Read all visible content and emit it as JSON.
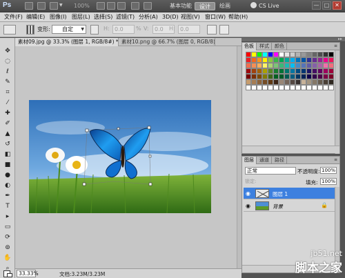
{
  "app": {
    "logo": "Ps",
    "zoom_display": "100%",
    "workspaces": [
      "基本功能",
      "设计",
      "绘画"
    ],
    "workspace_active": "设计",
    "live": "CS Live",
    "win_minimize": "—",
    "win_restore": "□",
    "win_close": "✕"
  },
  "menu": [
    "文件(F)",
    "编辑(E)",
    "图像(I)",
    "图层(L)",
    "选择(S)",
    "滤镜(T)",
    "分析(A)",
    "3D(D)",
    "视图(V)",
    "窗口(W)",
    "帮助(H)"
  ],
  "options": {
    "warp_label": "变形:",
    "warp_value": "自定",
    "h_label": "H:",
    "h_value": "0.0",
    "v_label": "V:",
    "v_value": "0.0",
    "h2_label": "H:",
    "h2_value": "0.0",
    "percent": "%"
  },
  "tabs": [
    {
      "label": "素材09.jpg @ 33.3% (图层 1, RGB/8#) *",
      "close": "×"
    },
    {
      "label": "素材10.png @ 66.7% (图层 0, RGB/8)",
      "close": "×"
    }
  ],
  "status": {
    "zoom": "33.33%",
    "doc": "文档:3.23M/3.23M"
  },
  "color_panel": {
    "tabs": [
      "色板",
      "样式",
      "颜色"
    ],
    "swatches": [
      "#ff0000",
      "#ffff00",
      "#00ff00",
      "#00ffff",
      "#0000ff",
      "#ff00ff",
      "#ffffff",
      "#e6e6e6",
      "#cccccc",
      "#b3b3b3",
      "#999999",
      "#808080",
      "#666666",
      "#4d4d4d",
      "#333333",
      "#000000",
      "#ee1d24",
      "#f26522",
      "#f7941d",
      "#fff200",
      "#8dc63f",
      "#39b54a",
      "#00a651",
      "#00a99d",
      "#00aeef",
      "#0072bc",
      "#0054a6",
      "#2e3192",
      "#662d91",
      "#92278f",
      "#ec008c",
      "#ed145b",
      "#f26c4f",
      "#f68e55",
      "#fbaf5c",
      "#fff467",
      "#acd372",
      "#7cc576",
      "#3bb878",
      "#1abbb4",
      "#00bff3",
      "#438cca",
      "#5574b9",
      "#605ca8",
      "#8560a8",
      "#a864a8",
      "#f06eaa",
      "#f26d7d",
      "#9e0b0f",
      "#a0410d",
      "#a36209",
      "#aba000",
      "#598527",
      "#1a7b30",
      "#007236",
      "#00746b",
      "#0076a3",
      "#004a80",
      "#003471",
      "#1b1464",
      "#440e62",
      "#630460",
      "#9e005d",
      "#9e0039",
      "#790000",
      "#7b2e00",
      "#7d4900",
      "#827b00",
      "#406618",
      "#005e20",
      "#005826",
      "#005952",
      "#005b7f",
      "#003663",
      "#002157",
      "#0d004c",
      "#32004b",
      "#4b0049",
      "#7b0046",
      "#7a0026",
      "#c69c6d",
      "#a67c52",
      "#8c6239",
      "#754c24",
      "#603913",
      "#3c2415",
      "#998675",
      "#736357",
      "#534741",
      "#362f2d",
      "#c7b299",
      "#a39580",
      "#847766",
      "#655a4d",
      "#493f35",
      "#2f2820",
      "#ffffff",
      "#ffffff",
      "#ffffff",
      "#ffffff",
      "#ffffff",
      "#ffffff",
      "#ffffff",
      "#ffffff",
      "#ffffff",
      "#ffffff",
      "#ffffff",
      "#ffffff",
      "#ffffff",
      "#ffffff",
      "#ffffff",
      "#ffffff"
    ]
  },
  "layers_panel": {
    "tabs": [
      "图层",
      "通道",
      "路径"
    ],
    "blend_mode": "正常",
    "opacity_label": "不透明度:",
    "opacity_value": "100%",
    "fill_label": "填充:",
    "fill_value": "100%",
    "lock_label": "锁定:",
    "layers": [
      {
        "name": "图层 1",
        "selected": true
      },
      {
        "name": "背景",
        "selected": false
      }
    ]
  },
  "watermark": {
    "line1": "jb51.net",
    "line2": "脚本之家"
  }
}
